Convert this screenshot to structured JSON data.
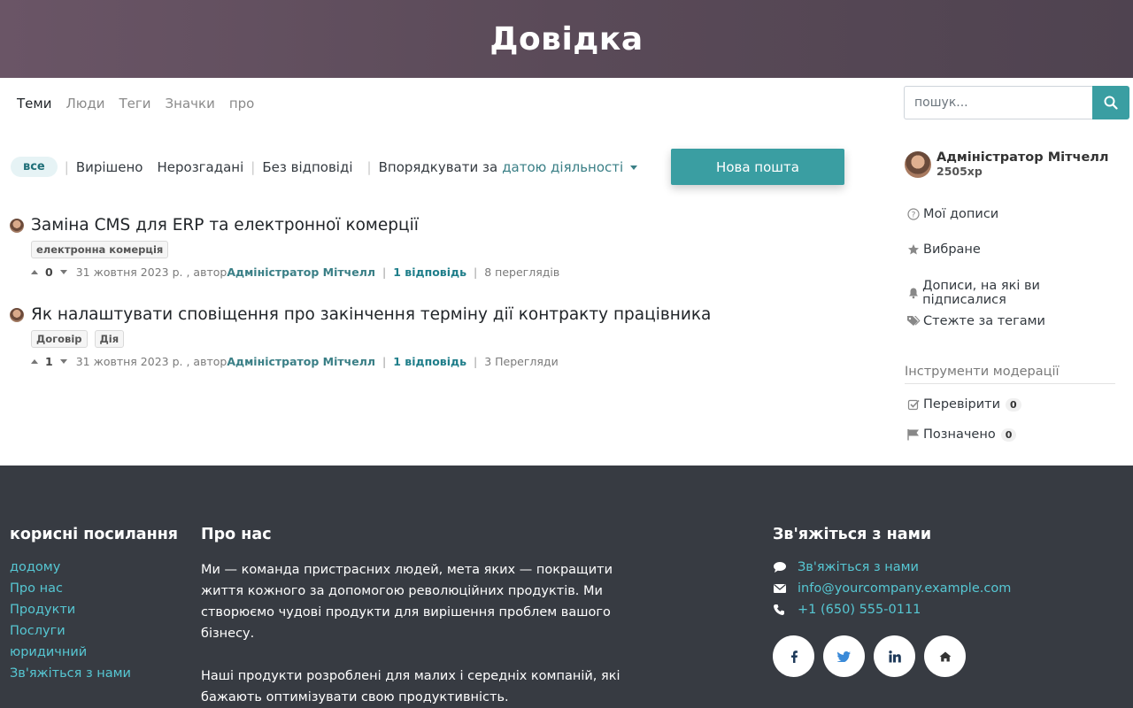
{
  "hero": {
    "title": "Довідка"
  },
  "nav": {
    "tabs": [
      "Теми",
      "Люди",
      "Теги",
      "Значки",
      "про"
    ],
    "search_placeholder": "пошук..."
  },
  "filters": {
    "all": "все",
    "solved": "Вирішено",
    "unsolved": "Нерозгадані",
    "unanswered": "Без відповіді",
    "sort_label": "Впорядкувати за",
    "sort_value": "датою діяльності"
  },
  "new_post_label": "Нова пошта",
  "posts": [
    {
      "title": "Заміна CMS для ERP та електронної комерції",
      "tags": [
        "електронна комерція"
      ],
      "votes": "0",
      "date": "31 жовтня 2023 р. , автор",
      "author": "Адміністратор Мітчелл",
      "answers": "1 відповідь",
      "views": "8 переглядів"
    },
    {
      "title": "Як налаштувати сповіщення про закінчення терміну дії контракту працівника",
      "tags": [
        "Договір",
        "Дія"
      ],
      "votes": "1",
      "date": "31 жовтня 2023 р. , автор",
      "author": "Адміністратор Мітчелл",
      "answers": "1 відповідь",
      "views": "3 Перегляди"
    }
  ],
  "sidebar": {
    "user_name": "Адміністратор Мітчелл",
    "user_xp": "2505xp",
    "links": {
      "my_posts": "Мої дописи",
      "favorites": "Вибране",
      "subscribed": "Дописи, на які ви підписалися",
      "followed_tags": "Стежте за тегами"
    },
    "mod_title": "Інструменти модерації",
    "review_label": "Перевірити",
    "review_count": "0",
    "flagged_label": "Позначено",
    "flagged_count": "0"
  },
  "footer": {
    "useful_title": "корисні посилання",
    "useful_links": [
      "додому",
      "Про нас",
      "Продукти",
      "Послуги",
      "юридичний",
      "Зв'яжіться з нами"
    ],
    "about_title": "Про нас",
    "about_p1": "Ми — команда пристрасних людей, мета яких — покращити життя кожного за допомогою революційних продуктів. Ми створюємо чудові продукти для вирішення проблем вашого бізнесу.",
    "about_p2": "Наші продукти розроблені для малих і середніх компаній, які бажають оптимізувати свою продуктивність.",
    "contact_title": "Зв'яжіться з нами",
    "contact_link": "Зв'яжіться з нами",
    "email": "info@yourcompany.example.com",
    "phone": "+1 (650) 555-0111",
    "socials": [
      "facebook-icon",
      "twitter-icon",
      "linkedin-icon",
      "home-icon"
    ]
  }
}
